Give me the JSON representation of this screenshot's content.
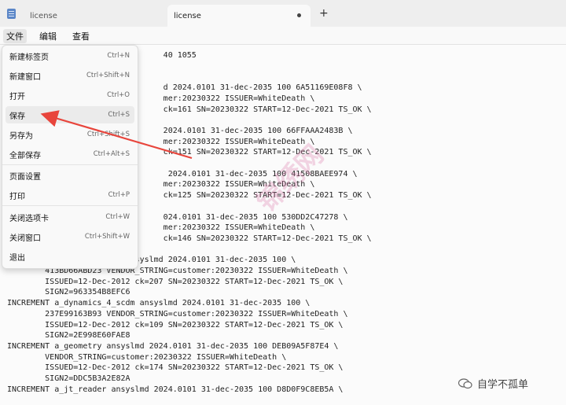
{
  "tabs": [
    {
      "label": "license"
    },
    {
      "label": "license"
    }
  ],
  "menubar": {
    "file": "文件",
    "edit": "编辑",
    "view": "查看"
  },
  "file_menu": [
    {
      "label": "新建标签页",
      "shortcut": "Ctrl+N"
    },
    {
      "label": "新建窗口",
      "shortcut": "Ctrl+Shift+N"
    },
    {
      "label": "打开",
      "shortcut": "Ctrl+O"
    },
    {
      "label": "保存",
      "shortcut": "Ctrl+S"
    },
    {
      "label": "另存为",
      "shortcut": "Ctrl+Shift+S"
    },
    {
      "label": "全部保存",
      "shortcut": "Ctrl+Alt+S"
    },
    {
      "label": "页面设置",
      "shortcut": ""
    },
    {
      "label": "打印",
      "shortcut": "Ctrl+P"
    },
    {
      "label": "关闭选项卡",
      "shortcut": "Ctrl+W"
    },
    {
      "label": "关闭窗口",
      "shortcut": "Ctrl+Shift+W"
    },
    {
      "label": "退出",
      "shortcut": ""
    }
  ],
  "editor_lines": [
    "                                 40 1055",
    "",
    "",
    "                                 d 2024.0101 31-dec-2035 100 6A51169E08F8 \\",
    "                                 mer:20230322 ISSUER=WhiteDeath \\",
    "                                 ck=161 SN=20230322 START=12-Dec-2021 TS_OK \\",
    "",
    "                                 2024.0101 31-dec-2035 100 66FFAAA2483B \\",
    "                                 mer:20230322 ISSUER=WhiteDeath \\",
    "                                 ck=151 SN=20230322 START=12-Dec-2021 TS_OK \\",
    "",
    "                                  2024.0101 31-dec-2035 100 41508BAEE974 \\",
    "                                 mer:20230322 ISSUER=WhiteDeath \\",
    "                                 ck=125 SN=20230322 START=12-Dec-2021 TS_OK \\",
    "",
    "                                 024.0101 31-dec-2035 100 530DD2C47278 \\",
    "                                 mer:20230322 ISSUER=WhiteDeath \\",
    "                                 ck=146 SN=20230322 START=12-Dec-2021 TS_OK \\",
    "",
    "INCREMENT a_catv6_reader ansyslmd 2024.0101 31-dec-2035 100 \\",
    "        413BD66ABD23 VENDOR_STRING=customer:20230322 ISSUER=WhiteDeath \\",
    "        ISSUED=12-Dec-2012 ck=207 SN=20230322 START=12-Dec-2021 TS_OK \\",
    "        SIGN2=963354B8EFC6",
    "INCREMENT a_dynamics_4_scdm ansyslmd 2024.0101 31-dec-2035 100 \\",
    "        237E99163B93 VENDOR_STRING=customer:20230322 ISSUER=WhiteDeath \\",
    "        ISSUED=12-Dec-2012 ck=109 SN=20230322 START=12-Dec-2021 TS_OK \\",
    "        SIGN2=2E998E60FAE8",
    "INCREMENT a_geometry ansyslmd 2024.0101 31-dec-2035 100 DEB09A5F87E4 \\",
    "        VENDOR_STRING=customer:20230322 ISSUER=WhiteDeath \\",
    "        ISSUED=12-Dec-2012 ck=174 SN=20230322 START=12-Dec-2021 TS_OK \\",
    "        SIGN2=DDC5B3A2E82A",
    "INCREMENT a_jt_reader ansyslmd 2024.0101 31-dec-2035 100 D8D0F9C8EB5A \\"
  ],
  "watermark": "锦绣网",
  "brand": "自学不孤单",
  "colors": {
    "arrow": "#e8453c"
  }
}
